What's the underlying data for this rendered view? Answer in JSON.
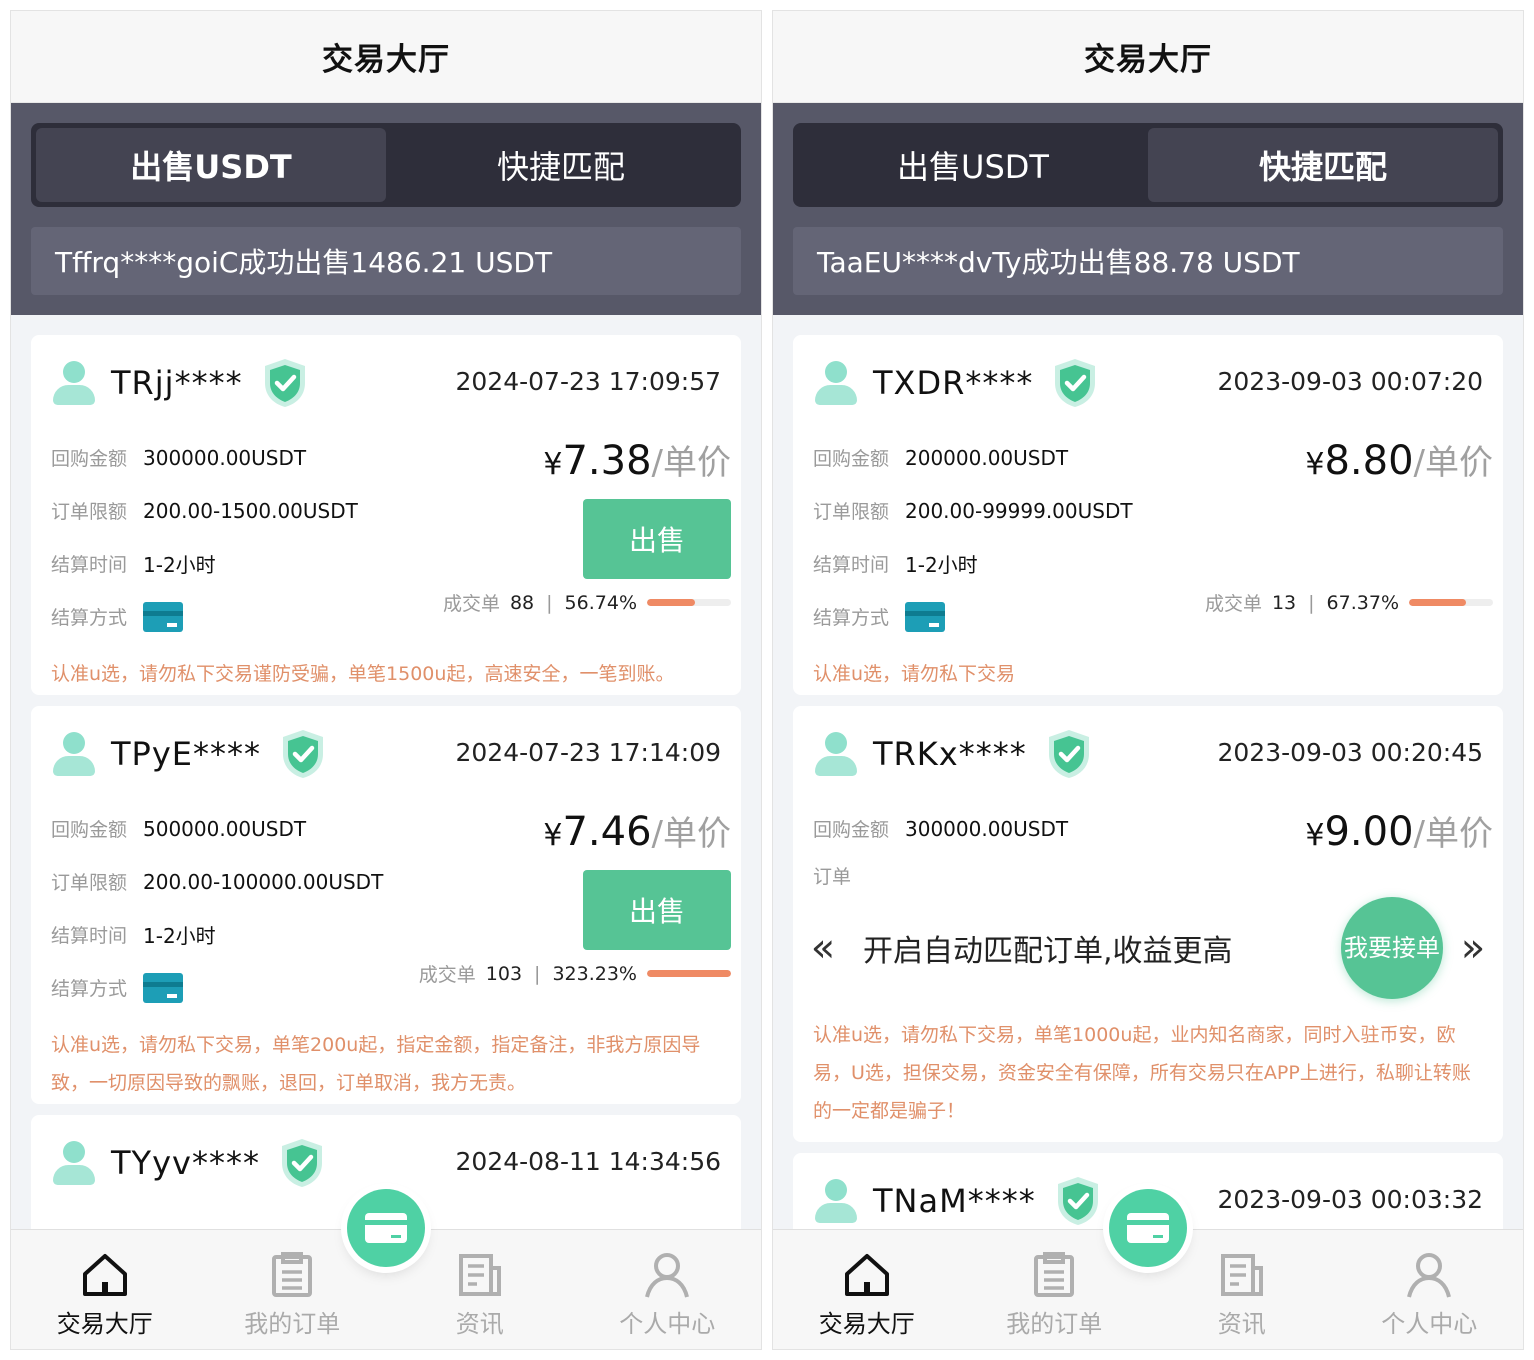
{
  "colors": {
    "accent": "#56c495",
    "dark_panel": "#575868",
    "progress": "#ef8a64",
    "note": "#e0906a",
    "pay_icon": "#1d9eb6"
  },
  "left": {
    "title": "交易大厅",
    "tabs": [
      {
        "label": "出售USDT",
        "active": true
      },
      {
        "label": "快捷匹配",
        "active": false
      }
    ],
    "ticker": "Tffrq****goiC成功出售1486.21 USDT",
    "labels": {
      "amount": "回购金额",
      "limit": "订单限额",
      "time": "结算时间",
      "method": "结算方式",
      "deals": "成交单",
      "unit": "/单价",
      "yen": "¥",
      "sell": "出售"
    },
    "cards": [
      {
        "user": "TRjj****",
        "time": "2024-07-23 17:09:57",
        "amount": "300000.00USDT",
        "limit": "200.00-1500.00USDT",
        "settle": "1-2小时",
        "price": "7.38",
        "deals": "88",
        "rate": "56.74%",
        "progress": 0.5674,
        "note": "认准u选，请勿私下交易谨防受骗，单笔1500u起，高速安全，一笔到账。"
      },
      {
        "user": "TPyE****",
        "time": "2024-07-23 17:14:09",
        "amount": "500000.00USDT",
        "limit": "200.00-100000.00USDT",
        "settle": "1-2小时",
        "price": "7.46",
        "deals": "103",
        "rate": "323.23%",
        "progress": 1.0,
        "note": "认准u选，请勿私下交易，单笔200u起，指定金额，指定备注，非我方原因导致，一切原因导致的飘账，退回，订单取消，我方无责。"
      },
      {
        "user": "TYyv****",
        "time": "2024-08-11 14:34:56"
      }
    ]
  },
  "right": {
    "title": "交易大厅",
    "tabs": [
      {
        "label": "出售USDT",
        "active": false
      },
      {
        "label": "快捷匹配",
        "active": true
      }
    ],
    "ticker": "TaaEU****dvTy成功出售88.78 USDT",
    "labels": {
      "amount": "回购金额",
      "limit": "订单限额",
      "time": "结算时间",
      "method": "结算方式",
      "deals": "成交单",
      "unit": "/单价",
      "yen": "¥",
      "limit_partial": "订单"
    },
    "cards": [
      {
        "user": "TXDR****",
        "time": "2023-09-03 00:07:20",
        "amount": "200000.00USDT",
        "limit": "200.00-99999.00USDT",
        "settle": "1-2小时",
        "price": "8.80",
        "deals": "13",
        "rate": "67.37%",
        "progress": 0.6737,
        "note": "认准u选，请勿私下交易"
      },
      {
        "user": "TRKx****",
        "time": "2023-09-03 00:20:45",
        "amount": "300000.00USDT",
        "price": "9.00",
        "note": "认准u选，请勿私下交易，单笔1000u起，业内知名商家，同时入驻币安，欧易，U选，担保交易，资金安全有保障，所有交易只在APP上进行，私聊让转账的一定都是骗子！"
      },
      {
        "user": "TNaM****",
        "time": "2023-09-03 00:03:32"
      }
    ],
    "overlay": {
      "text": "开启自动匹配订单,收益更高",
      "button": "我要接单",
      "prev": "«",
      "next": "»"
    }
  },
  "nav": [
    {
      "label": "交易大厅",
      "icon": "home-icon",
      "active": true
    },
    {
      "label": "我的订单",
      "icon": "clipboard-icon",
      "active": false
    },
    {
      "label": "资讯",
      "icon": "news-icon",
      "active": false
    },
    {
      "label": "个人中心",
      "icon": "user-icon",
      "active": false
    }
  ]
}
